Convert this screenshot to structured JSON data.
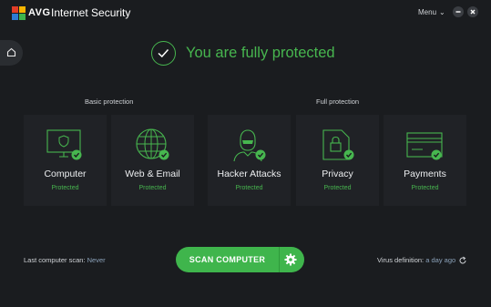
{
  "window": {
    "brand": "AVG",
    "title": "Internet Security",
    "menu_label": "Menu"
  },
  "status": {
    "message": "You are fully protected"
  },
  "groups": {
    "basic": "Basic protection",
    "full": "Full protection"
  },
  "cards": [
    {
      "name": "Computer",
      "state": "Protected",
      "icon": "monitor-shield-icon"
    },
    {
      "name": "Web & Email",
      "state": "Protected",
      "icon": "globe-icon"
    },
    {
      "name": "Hacker Attacks",
      "state": "Protected",
      "icon": "hacker-icon"
    },
    {
      "name": "Privacy",
      "state": "Protected",
      "icon": "lock-document-icon"
    },
    {
      "name": "Payments",
      "state": "Protected",
      "icon": "credit-card-icon"
    }
  ],
  "footer": {
    "last_scan_label": "Last computer scan:",
    "last_scan_value": "Never",
    "scan_button": "SCAN COMPUTER",
    "virus_def_label": "Virus definition:",
    "virus_def_value": "a day ago"
  },
  "colors": {
    "accent": "#47b64f",
    "background": "#1a1c1f",
    "card": "#202226"
  }
}
